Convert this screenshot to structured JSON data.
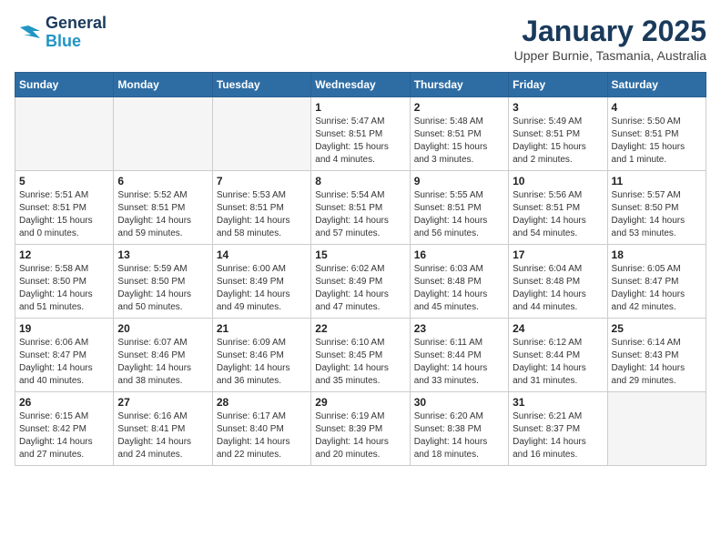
{
  "header": {
    "logo_line1": "General",
    "logo_line2": "Blue",
    "month": "January 2025",
    "location": "Upper Burnie, Tasmania, Australia"
  },
  "weekdays": [
    "Sunday",
    "Monday",
    "Tuesday",
    "Wednesday",
    "Thursday",
    "Friday",
    "Saturday"
  ],
  "weeks": [
    [
      {
        "day": "",
        "info": ""
      },
      {
        "day": "",
        "info": ""
      },
      {
        "day": "",
        "info": ""
      },
      {
        "day": "1",
        "info": "Sunrise: 5:47 AM\nSunset: 8:51 PM\nDaylight: 15 hours\nand 4 minutes."
      },
      {
        "day": "2",
        "info": "Sunrise: 5:48 AM\nSunset: 8:51 PM\nDaylight: 15 hours\nand 3 minutes."
      },
      {
        "day": "3",
        "info": "Sunrise: 5:49 AM\nSunset: 8:51 PM\nDaylight: 15 hours\nand 2 minutes."
      },
      {
        "day": "4",
        "info": "Sunrise: 5:50 AM\nSunset: 8:51 PM\nDaylight: 15 hours\nand 1 minute."
      }
    ],
    [
      {
        "day": "5",
        "info": "Sunrise: 5:51 AM\nSunset: 8:51 PM\nDaylight: 15 hours\nand 0 minutes."
      },
      {
        "day": "6",
        "info": "Sunrise: 5:52 AM\nSunset: 8:51 PM\nDaylight: 14 hours\nand 59 minutes."
      },
      {
        "day": "7",
        "info": "Sunrise: 5:53 AM\nSunset: 8:51 PM\nDaylight: 14 hours\nand 58 minutes."
      },
      {
        "day": "8",
        "info": "Sunrise: 5:54 AM\nSunset: 8:51 PM\nDaylight: 14 hours\nand 57 minutes."
      },
      {
        "day": "9",
        "info": "Sunrise: 5:55 AM\nSunset: 8:51 PM\nDaylight: 14 hours\nand 56 minutes."
      },
      {
        "day": "10",
        "info": "Sunrise: 5:56 AM\nSunset: 8:51 PM\nDaylight: 14 hours\nand 54 minutes."
      },
      {
        "day": "11",
        "info": "Sunrise: 5:57 AM\nSunset: 8:50 PM\nDaylight: 14 hours\nand 53 minutes."
      }
    ],
    [
      {
        "day": "12",
        "info": "Sunrise: 5:58 AM\nSunset: 8:50 PM\nDaylight: 14 hours\nand 51 minutes."
      },
      {
        "day": "13",
        "info": "Sunrise: 5:59 AM\nSunset: 8:50 PM\nDaylight: 14 hours\nand 50 minutes."
      },
      {
        "day": "14",
        "info": "Sunrise: 6:00 AM\nSunset: 8:49 PM\nDaylight: 14 hours\nand 49 minutes."
      },
      {
        "day": "15",
        "info": "Sunrise: 6:02 AM\nSunset: 8:49 PM\nDaylight: 14 hours\nand 47 minutes."
      },
      {
        "day": "16",
        "info": "Sunrise: 6:03 AM\nSunset: 8:48 PM\nDaylight: 14 hours\nand 45 minutes."
      },
      {
        "day": "17",
        "info": "Sunrise: 6:04 AM\nSunset: 8:48 PM\nDaylight: 14 hours\nand 44 minutes."
      },
      {
        "day": "18",
        "info": "Sunrise: 6:05 AM\nSunset: 8:47 PM\nDaylight: 14 hours\nand 42 minutes."
      }
    ],
    [
      {
        "day": "19",
        "info": "Sunrise: 6:06 AM\nSunset: 8:47 PM\nDaylight: 14 hours\nand 40 minutes."
      },
      {
        "day": "20",
        "info": "Sunrise: 6:07 AM\nSunset: 8:46 PM\nDaylight: 14 hours\nand 38 minutes."
      },
      {
        "day": "21",
        "info": "Sunrise: 6:09 AM\nSunset: 8:46 PM\nDaylight: 14 hours\nand 36 minutes."
      },
      {
        "day": "22",
        "info": "Sunrise: 6:10 AM\nSunset: 8:45 PM\nDaylight: 14 hours\nand 35 minutes."
      },
      {
        "day": "23",
        "info": "Sunrise: 6:11 AM\nSunset: 8:44 PM\nDaylight: 14 hours\nand 33 minutes."
      },
      {
        "day": "24",
        "info": "Sunrise: 6:12 AM\nSunset: 8:44 PM\nDaylight: 14 hours\nand 31 minutes."
      },
      {
        "day": "25",
        "info": "Sunrise: 6:14 AM\nSunset: 8:43 PM\nDaylight: 14 hours\nand 29 minutes."
      }
    ],
    [
      {
        "day": "26",
        "info": "Sunrise: 6:15 AM\nSunset: 8:42 PM\nDaylight: 14 hours\nand 27 minutes."
      },
      {
        "day": "27",
        "info": "Sunrise: 6:16 AM\nSunset: 8:41 PM\nDaylight: 14 hours\nand 24 minutes."
      },
      {
        "day": "28",
        "info": "Sunrise: 6:17 AM\nSunset: 8:40 PM\nDaylight: 14 hours\nand 22 minutes."
      },
      {
        "day": "29",
        "info": "Sunrise: 6:19 AM\nSunset: 8:39 PM\nDaylight: 14 hours\nand 20 minutes."
      },
      {
        "day": "30",
        "info": "Sunrise: 6:20 AM\nSunset: 8:38 PM\nDaylight: 14 hours\nand 18 minutes."
      },
      {
        "day": "31",
        "info": "Sunrise: 6:21 AM\nSunset: 8:37 PM\nDaylight: 14 hours\nand 16 minutes."
      },
      {
        "day": "",
        "info": ""
      }
    ]
  ]
}
